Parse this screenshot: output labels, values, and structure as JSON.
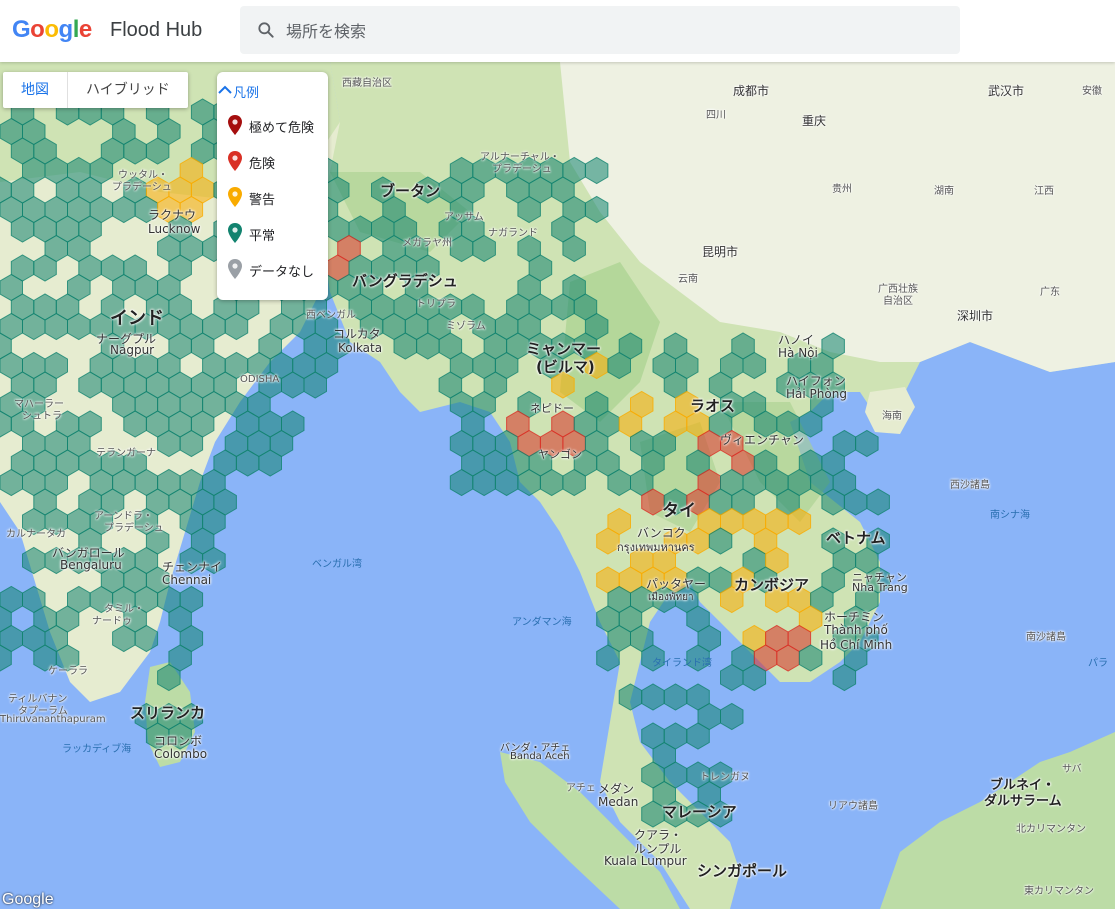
{
  "header": {
    "logo_letters": [
      {
        "ch": "G",
        "color": "#4285F4"
      },
      {
        "ch": "o",
        "color": "#EA4335"
      },
      {
        "ch": "o",
        "color": "#FBBC05"
      },
      {
        "ch": "g",
        "color": "#4285F4"
      },
      {
        "ch": "l",
        "color": "#34A853"
      },
      {
        "ch": "e",
        "color": "#EA4335"
      }
    ],
    "product": "Flood Hub",
    "search_placeholder": "場所を検索"
  },
  "map_type": {
    "map_label": "地図",
    "hybrid_label": "ハイブリッド"
  },
  "legend": {
    "title": "凡例",
    "items": [
      {
        "label": "極めて危険",
        "color": "#a50e0e"
      },
      {
        "label": "危険",
        "color": "#d93025"
      },
      {
        "label": "警告",
        "color": "#f9ab00"
      },
      {
        "label": "平常",
        "color": "#12836f"
      },
      {
        "label": "データなし",
        "color": "#9aa0a6"
      }
    ]
  },
  "map_labels": {
    "countries": {
      "bhutan": "ブータン",
      "bangladesh": "バングラデシュ",
      "india": "インド",
      "myanmar": "ミャンマー",
      "myanmar_sub": "(ビルマ)",
      "laos": "ラオス",
      "thailand": "タイ",
      "cambodia": "カンボジア",
      "vietnam": "ベトナム",
      "malaysia": "マレーシア",
      "singapore": "シンガポール",
      "srilanka": "スリランカ",
      "brunei": "ブルネイ・",
      "brunei_sub": "ダルサラーム"
    },
    "cities": {
      "lucknow_jp": "ラクナウ",
      "lucknow": "Lucknow",
      "nagpur_jp": "ナーグプル",
      "nagpur": "Nagpur",
      "kolkata_jp": "コルカタ",
      "kolkata": "Kolkata",
      "bengaluru_jp": "バンガロール",
      "bengaluru": "Bengaluru",
      "chennai_jp": "チェンナイ",
      "chennai": "Chennai",
      "colombo_jp": "コロンボ",
      "colombo": "Colombo",
      "chengdu": "成都市",
      "chongqing": "重庆",
      "wuhan": "武汉市",
      "kunming": "昆明市",
      "shenzhen": "深圳市",
      "hanoi_jp": "ハノイ",
      "hanoi": "Hà Nội",
      "haiphong_jp": "ハイフォン",
      "haiphong": "Hải Phòng",
      "vientiane_jp": "ヴィエンチャン",
      "bangkok_jp": "バンコク",
      "bangkok": "กรุงเทพมหานคร",
      "pattaya_jp": "パッタヤー",
      "pattaya": "เมืองพัทยา",
      "hcmc_jp": "ホーチミン",
      "hcmc1": "Thành phố",
      "hcmc2": "Hồ Chí Minh",
      "nhatrang_jp": "ニャチャン",
      "nhatrang": "Nha Trang",
      "medan_jp": "メダン",
      "medan": "Medan",
      "kl_jp": "クアラ・",
      "kl_jp2": "ルンプル",
      "kl": "Kuala Lumpur",
      "naypyidaw": "ネピドー",
      "yangon": "ヤンゴン",
      "bandaaceh_jp": "バンダ・アチェ",
      "bandaaceh": "Banda Aceh"
    },
    "regions": {
      "tibet": "西藏自治区",
      "sichuan": "四川",
      "guizhou": "贵州",
      "hunan": "湖南",
      "jiangxi": "江西",
      "yunnan": "云南",
      "guangxi1": "广西壮族",
      "guangxi2": "自治区",
      "guangdong": "广东",
      "hainan": "海南",
      "anhui": "安徽",
      "odisha": "ODISHA",
      "assam": "アッサム",
      "uttar": "ウッタル・",
      "uttar2": "プラデーシュ",
      "maha": "マハーラー",
      "maha2": "シュトラ",
      "telangana": "テランガーナ",
      "karnataka": "カルナータカ",
      "kerala": "ケーララ",
      "tamil": "タミル・",
      "tamil2": "ナードゥ",
      "arunachal": "アルナーチャル・",
      "arunachal2": "プラデーシュ",
      "nagaland": "ナガランド",
      "meghalaya": "メガラヤ州",
      "mizoram": "ミゾラム",
      "tripura": "トリプラ",
      "bengal": "西ベンガル",
      "trivandrum": "ティルバナン",
      "trivandrum2": "タプーラム",
      "trivandrum3": "Thiruvananthapuram",
      "paracel": "西沙諸島",
      "spratly": "南沙諸島",
      "natuna": "リアウ諸島",
      "sabah": "サバ",
      "kalimantan": "北カリマンタン",
      "eastkal": "東カリマンタン",
      "andhra": "アーンドラ・",
      "andhra2": "プラデーシュ",
      "aceh": "アチェ",
      "trengganu": "トレンガヌ"
    },
    "water": {
      "bengal_bay": "ベンガル湾",
      "andaman": "アンダマン海",
      "thailand_gulf": "タイランド湾",
      "scs": "南シナ海",
      "laccadive": "ラッカディブ海",
      "paracel2": "パラ"
    }
  },
  "attribution": "Google"
}
